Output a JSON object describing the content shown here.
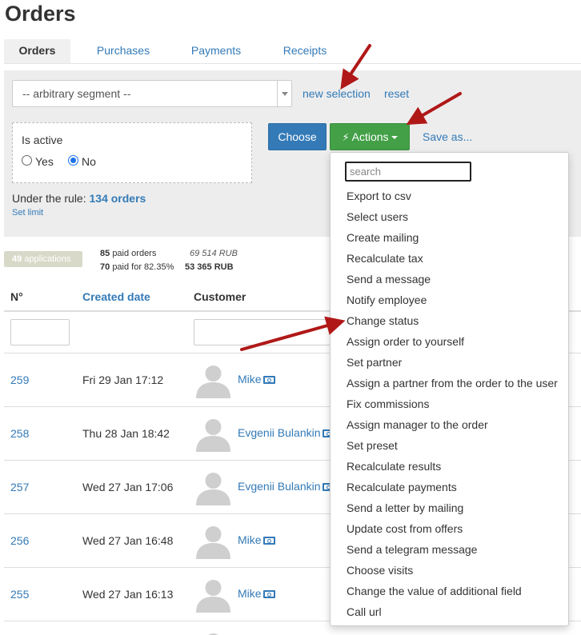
{
  "page": {
    "title": "Orders"
  },
  "tabs": [
    {
      "label": "Orders",
      "active": true
    },
    {
      "label": "Purchases",
      "active": false
    },
    {
      "label": "Payments",
      "active": false
    },
    {
      "label": "Receipts",
      "active": false
    }
  ],
  "filter": {
    "segment_value": "-- arbitrary segment --",
    "new_selection": "new selection",
    "reset": "reset",
    "is_active_label": "Is active",
    "yes_label": "Yes",
    "no_label": "No",
    "selected": "No",
    "rule_prefix": "Under the rule:",
    "rule_count": "134 orders",
    "set_limit": "Set limit",
    "choose_label": "Choose",
    "actions_label": "Actions",
    "save_as": "Save as..."
  },
  "summary": {
    "apps_count": "49",
    "apps_label": "applications",
    "paid_orders_count": "85",
    "paid_orders_label": "paid orders",
    "paid_orders_amount": "69 514 RUB",
    "paid_for_count": "70",
    "paid_for_label": "paid for 82.35%",
    "paid_for_amount": "53 365 RUB"
  },
  "table": {
    "headers": {
      "num": "N°",
      "created": "Created date",
      "customer": "Customer"
    },
    "rows": [
      {
        "num": "259",
        "date": "Fri 29 Jan 17:12",
        "customer": "Mike"
      },
      {
        "num": "258",
        "date": "Thu 28 Jan 18:42",
        "customer": "Evgenii Bulankin"
      },
      {
        "num": "257",
        "date": "Wed 27 Jan 17:06",
        "customer": "Evgenii Bulankin"
      },
      {
        "num": "256",
        "date": "Wed 27 Jan 16:48",
        "customer": "Mike"
      },
      {
        "num": "255",
        "date": "Wed 27 Jan 16:13",
        "customer": "Mike"
      }
    ]
  },
  "actions_menu": {
    "search_placeholder": "search",
    "items": [
      "Export to csv",
      "Select users",
      "Create mailing",
      "Recalculate tax",
      "Send a message",
      "Notify employee",
      "Change status",
      "Assign order to yourself",
      "Set partner",
      "Assign a partner from the order to the user",
      "Fix commissions",
      "Assign manager to the order",
      "Set preset",
      "Recalculate results",
      "Recalculate payments",
      "Send a letter by mailing",
      "Update cost from offers",
      "Send a telegram message",
      "Choose visits",
      "Change the value of additional field",
      "Call url"
    ]
  },
  "colors": {
    "primary": "#337ab7",
    "success": "#43a047",
    "arrow": "#b01818"
  }
}
